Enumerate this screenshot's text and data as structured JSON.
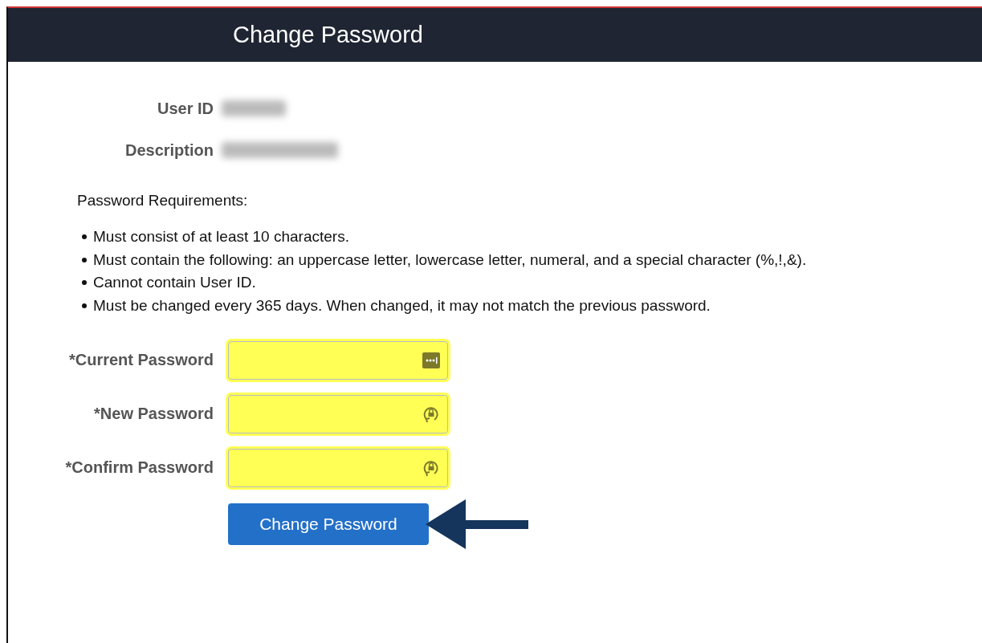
{
  "header": {
    "title": "Change Password"
  },
  "info": [
    {
      "label": "User ID",
      "redacted": true
    },
    {
      "label": "Description",
      "redacted": true
    }
  ],
  "requirements": {
    "heading": "Password Requirements:",
    "items": [
      "Must consist of at least 10 characters.",
      "Must contain the following: an uppercase letter, lowercase letter, numeral, and a special character (%,!,&).",
      "Cannot contain User ID.",
      "Must be changed every 365 days. When changed, it may not match the previous password."
    ]
  },
  "fields": [
    {
      "label": "*Current Password",
      "kind": "current",
      "highlighted": true
    },
    {
      "label": "*New Password",
      "kind": "new",
      "highlighted": true
    },
    {
      "label": "*Confirm Password",
      "kind": "new",
      "highlighted": true
    }
  ],
  "button": {
    "label": "Change Password"
  },
  "arrow": {
    "kind": "pointer"
  }
}
